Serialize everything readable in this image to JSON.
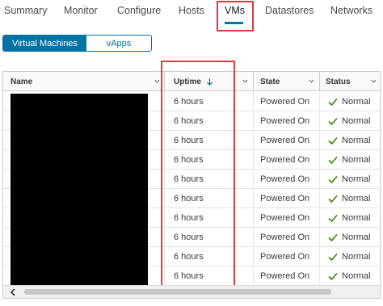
{
  "tabs": [
    {
      "label": "Summary"
    },
    {
      "label": "Monitor"
    },
    {
      "label": "Configure"
    },
    {
      "label": "Hosts"
    },
    {
      "label": "VMs",
      "active": true
    },
    {
      "label": "Datastores"
    },
    {
      "label": "Networks"
    }
  ],
  "toggle": {
    "selected": "Virtual Machines",
    "options": [
      "Virtual Machines",
      "vApps"
    ]
  },
  "grid": {
    "columns": [
      "Name",
      "Uptime",
      "State",
      "Status"
    ],
    "sorted_column": "Uptime",
    "sort_direction": "descending",
    "rows": [
      {
        "uptime": "6 hours",
        "state": "Powered On",
        "status": "Normal"
      },
      {
        "uptime": "6 hours",
        "state": "Powered On",
        "status": "Normal"
      },
      {
        "uptime": "6 hours",
        "state": "Powered On",
        "status": "Normal"
      },
      {
        "uptime": "6 hours",
        "state": "Powered On",
        "status": "Normal"
      },
      {
        "uptime": "6 hours",
        "state": "Powered On",
        "status": "Normal"
      },
      {
        "uptime": "6 hours",
        "state": "Powered On",
        "status": "Normal"
      },
      {
        "uptime": "6 hours",
        "state": "Powered On",
        "status": "Normal"
      },
      {
        "uptime": "6 hours",
        "state": "Powered On",
        "status": "Normal"
      },
      {
        "uptime": "6 hours",
        "state": "Powered On",
        "status": "Normal"
      },
      {
        "uptime": "6 hours",
        "state": "Powered On",
        "status": "Normal"
      }
    ]
  },
  "colors": {
    "accent": "#0072a3",
    "highlight": "#e03a3a",
    "status_ok": "#3c8500"
  },
  "icons": {
    "sort": "arrow-down-icon",
    "column_menu": "chevron-down-icon",
    "status_ok": "check-icon",
    "scroll_left": "chevron-left-icon"
  }
}
